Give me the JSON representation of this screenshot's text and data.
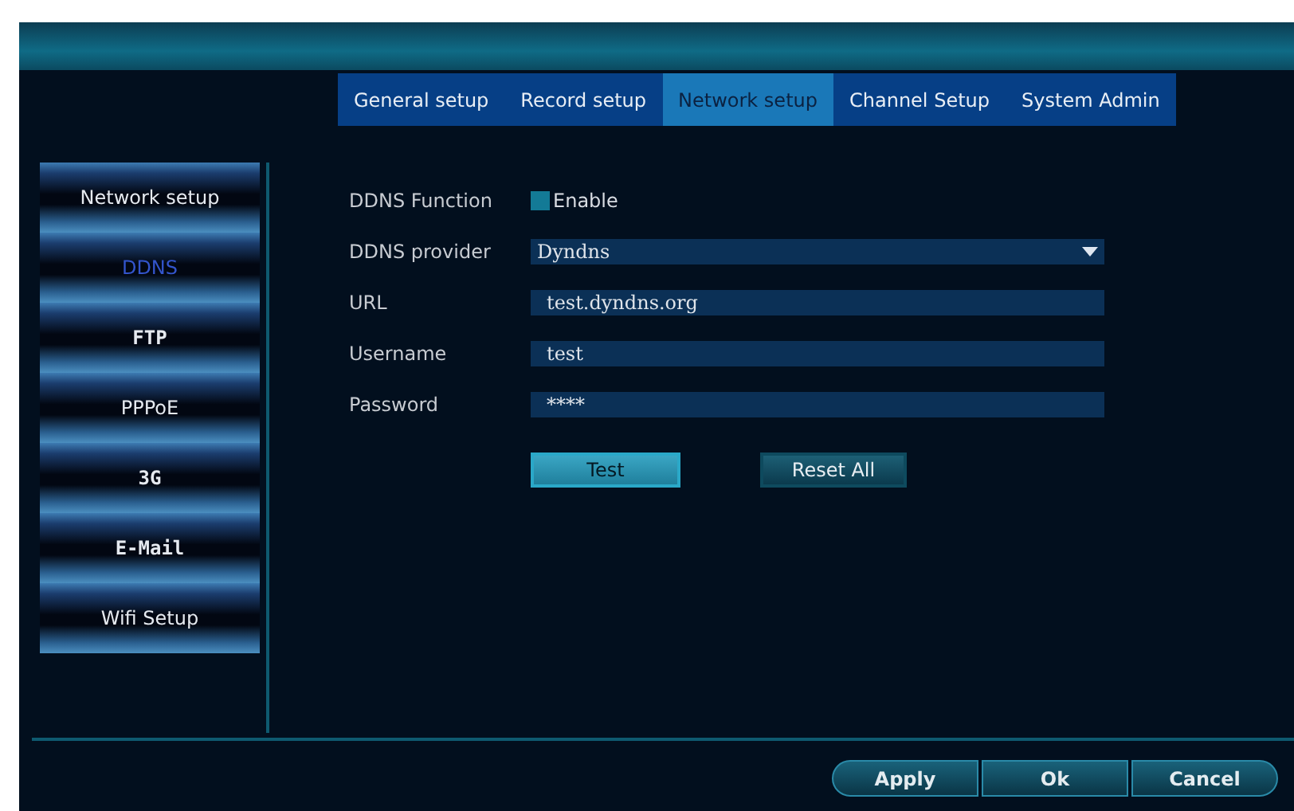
{
  "tabs": [
    {
      "label": "General setup",
      "selected": false
    },
    {
      "label": "Record setup",
      "selected": false
    },
    {
      "label": "Network setup",
      "selected": true
    },
    {
      "label": "Channel Setup",
      "selected": false
    },
    {
      "label": "System Admin",
      "selected": false
    }
  ],
  "sidebar": {
    "items": [
      {
        "label": "Network setup",
        "selected": false,
        "mono": false
      },
      {
        "label": "DDNS",
        "selected": true,
        "mono": false
      },
      {
        "label": "FTP",
        "selected": false,
        "mono": true
      },
      {
        "label": "PPPoE",
        "selected": false,
        "mono": false
      },
      {
        "label": "3G",
        "selected": false,
        "mono": true
      },
      {
        "label": "E-Mail",
        "selected": false,
        "mono": true
      },
      {
        "label": "Wifi Setup",
        "selected": false,
        "mono": false
      }
    ]
  },
  "form": {
    "rows": [
      {
        "kind": "checkbox",
        "label": "DDNS Function",
        "option": "Enable",
        "checked": true
      },
      {
        "kind": "dropdown",
        "label": "DDNS provider",
        "value": "Dyndns"
      },
      {
        "kind": "text",
        "label": "URL",
        "value": "test.dyndns.org"
      },
      {
        "kind": "text",
        "label": "Username",
        "value": "test"
      },
      {
        "kind": "password",
        "label": "Password",
        "value": "****"
      }
    ],
    "buttons": [
      {
        "label": "Test",
        "focused": true
      },
      {
        "label": "Reset All",
        "focused": false
      }
    ]
  },
  "footer_buttons": [
    "Apply",
    "Ok",
    "Cancel"
  ]
}
